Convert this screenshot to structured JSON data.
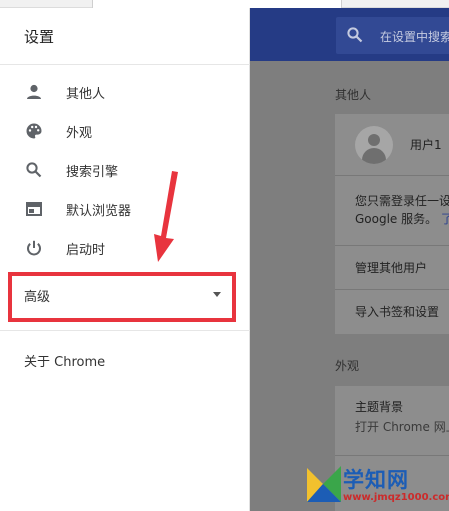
{
  "drawer": {
    "title": "设置",
    "items": [
      {
        "label": "其他人",
        "icon": "person-icon"
      },
      {
        "label": "外观",
        "icon": "palette-icon"
      },
      {
        "label": "搜索引擎",
        "icon": "search-icon"
      },
      {
        "label": "默认浏览器",
        "icon": "browser-window-icon"
      },
      {
        "label": "启动时",
        "icon": "power-icon"
      }
    ],
    "advanced_label": "高级",
    "about_label": "关于 Chrome"
  },
  "header": {
    "search_placeholder": "在设置中搜索"
  },
  "main": {
    "people_section_title": "其他人",
    "user_name": "用户1",
    "sign_in_text_line1": "您只需登录任一设",
    "sign_in_text_line2": "Google 服务。",
    "sign_in_link": "了",
    "manage_other_users": "管理其他用户",
    "import_bookmarks": "导入书签和设置",
    "appearance_section_title": "外观",
    "theme_title": "主题背景",
    "theme_sub": "打开 Chrome 网上"
  },
  "watermark": {
    "title": "学知网",
    "url": "www.jmqz1000.com"
  },
  "colors": {
    "header_blue": "#253b85",
    "highlight_red": "#e8343e",
    "overlay_gray": "#7e7e7e"
  }
}
